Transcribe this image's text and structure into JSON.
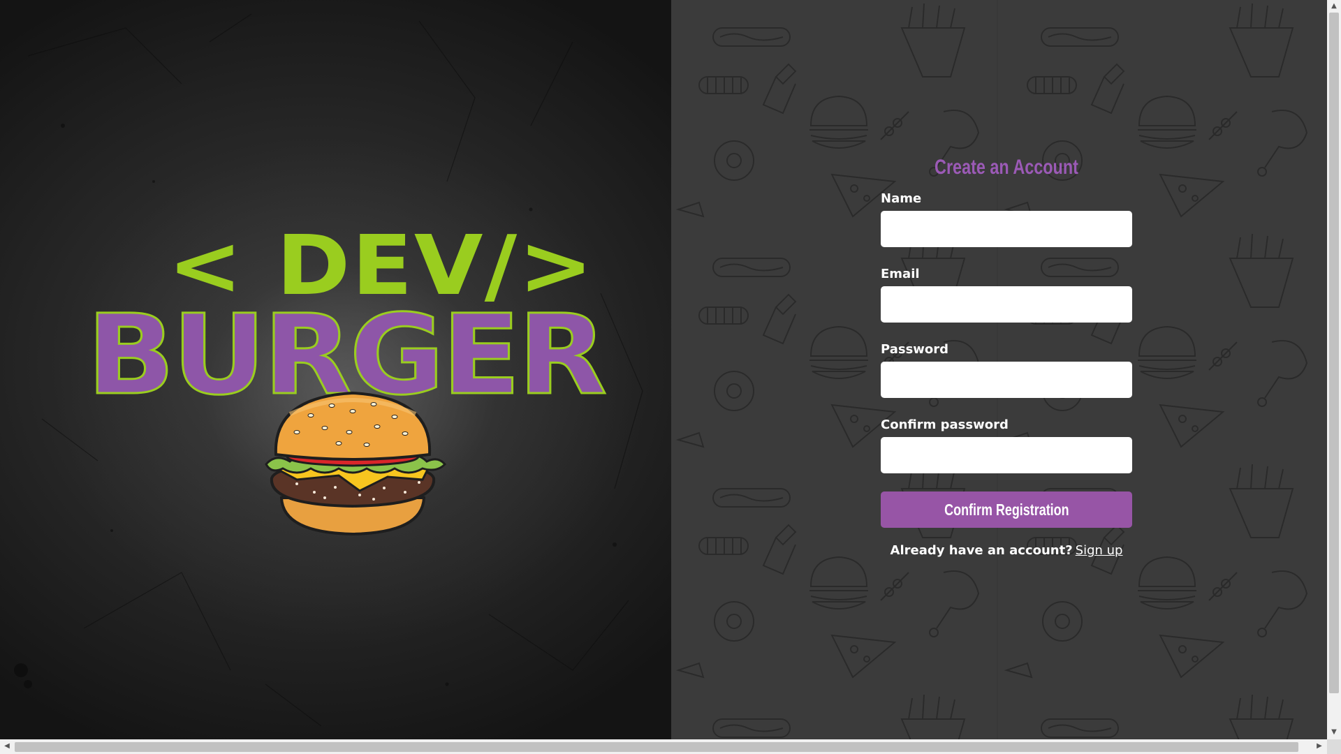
{
  "brand": {
    "logo_top": "< DEV/>",
    "logo_main": "BURGER",
    "colors": {
      "green": "#9ACD1F",
      "purple": "#8E56A8"
    }
  },
  "form": {
    "title": "Create an Account",
    "fields": [
      {
        "label": "Name",
        "value": "",
        "placeholder": ""
      },
      {
        "label": "Email",
        "value": "",
        "placeholder": ""
      },
      {
        "label": "Password",
        "value": "",
        "placeholder": ""
      },
      {
        "label": "Confirm password",
        "value": "",
        "placeholder": ""
      }
    ],
    "submit_label": "Confirm Registration",
    "footer_question": "Already have an account?",
    "footer_link": "Sign up",
    "accent_color": "#9755A6"
  },
  "icons": {
    "scroll_left": "arrow-left-icon",
    "scroll_right": "arrow-right-icon",
    "scroll_up": "arrow-up-icon",
    "scroll_down": "arrow-down-icon"
  }
}
